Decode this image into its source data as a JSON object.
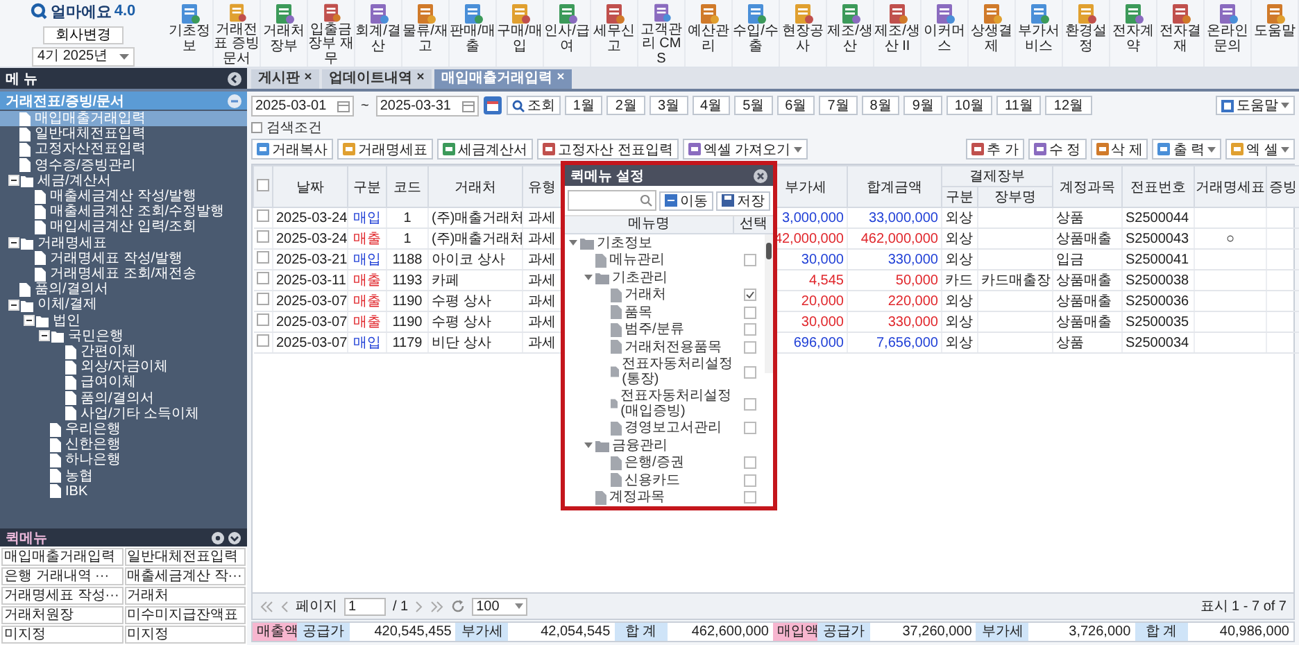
{
  "logo": {
    "name": "얼마에요",
    "version": "4.0"
  },
  "company_button": "회사변경",
  "period": "4기 2025년",
  "toolbar": [
    "기초정보",
    "거래전표 증빙문서",
    "거래처장부",
    "입출금장부 재무",
    "회계/결산",
    "물류/재고",
    "판매/매출",
    "구매/매입",
    "인사/급여",
    "세무신고",
    "고객관리 CMS",
    "예산관리",
    "수입/수출",
    "현장공사",
    "제조/생산",
    "제조/생산 II",
    "이커머스",
    "상생결제",
    "부가서비스",
    "환경설정",
    "전자계약",
    "전자결재",
    "온라인문의",
    "도움말"
  ],
  "menu_title": "메 뉴",
  "tabs": [
    {
      "label": "게시판",
      "selected": false
    },
    {
      "label": "업데이트내역",
      "selected": false
    },
    {
      "label": "매입매출거래입력",
      "selected": true
    }
  ],
  "sidebar": {
    "section": "거래전표/증빙/문서",
    "tree": [
      {
        "label": "매입매출거래입력",
        "kind": "file",
        "selected": true
      },
      {
        "label": "일반대체전표입력",
        "kind": "file",
        "selected": false
      },
      {
        "label": "고정자산전표입력",
        "kind": "file",
        "selected": false
      },
      {
        "label": "영수증/증빙관리",
        "kind": "file",
        "selected": false
      },
      {
        "label": "세금/계산서",
        "kind": "folder",
        "expanded": true,
        "selected": false,
        "children": [
          {
            "label": "매출세금계산 작성/발행",
            "kind": "file",
            "selected": false
          },
          {
            "label": "매출세금계산 조회/수정발행",
            "kind": "file",
            "selected": false
          },
          {
            "label": "매입세금계산 입력/조회",
            "kind": "file",
            "selected": false
          }
        ]
      },
      {
        "label": "거래명세표",
        "kind": "folder",
        "expanded": true,
        "selected": false,
        "children": [
          {
            "label": "거래명세표 작성/발행",
            "kind": "file",
            "selected": false
          },
          {
            "label": "거래명세표 조회/재전송",
            "kind": "file",
            "selected": false
          }
        ]
      },
      {
        "label": "품의/결의서",
        "kind": "file",
        "selected": false
      },
      {
        "label": "이체/결제",
        "kind": "folder",
        "expanded": true,
        "selected": false,
        "children": [
          {
            "label": "법인",
            "kind": "folder",
            "expanded": true,
            "selected": false,
            "children": [
              {
                "label": "국민은행",
                "kind": "folder",
                "expanded": true,
                "selected": false,
                "children": [
                  {
                    "label": "간편이체",
                    "kind": "file",
                    "selected": false
                  },
                  {
                    "label": "외상/자금이체",
                    "kind": "file",
                    "selected": false
                  },
                  {
                    "label": "급여이체",
                    "kind": "file",
                    "selected": false
                  },
                  {
                    "label": "품의/결의서",
                    "kind": "file",
                    "selected": false
                  },
                  {
                    "label": "사업/기타 소득이체",
                    "kind": "file",
                    "selected": false
                  }
                ]
              },
              {
                "label": "우리은행",
                "kind": "file",
                "selected": false
              },
              {
                "label": "신한은행",
                "kind": "file",
                "selected": false
              },
              {
                "label": "하나은행",
                "kind": "file",
                "selected": false
              },
              {
                "label": "농협",
                "kind": "file",
                "selected": false
              },
              {
                "label": "IBK",
                "kind": "file",
                "selected": false
              }
            ]
          }
        ]
      }
    ],
    "quick_title": "퀵메뉴",
    "quick_menu": [
      "매입매출거래입력",
      "일반대체전표입력",
      "은행 거래내역 ···",
      "매출세금계산 작···",
      "거래명세표 작성···",
      "거래처",
      "거래처원장",
      "미수미지급잔액표",
      "미지정",
      "미지정"
    ]
  },
  "filters": {
    "date_from": "2025-03-01",
    "tilde": "~",
    "date_to": "2025-03-31",
    "search_button": "조회",
    "months": [
      "1월",
      "2월",
      "3월",
      "4월",
      "5월",
      "6월",
      "7월",
      "8월",
      "9월",
      "10월",
      "11월",
      "12월"
    ],
    "help": "도움말"
  },
  "search_conditions": {
    "label": "검색조건",
    "expanded": false
  },
  "actions_left": [
    "거래복사",
    "거래명세표",
    "세금계산서",
    "고정자산 전표입력",
    "엑셀 가져오기"
  ],
  "actions_right": [
    "추 가",
    "수 정",
    "삭 제",
    "출 력",
    "엑 셀"
  ],
  "table": {
    "all_checked": false,
    "columns": [
      {
        "label": "날짜"
      },
      {
        "label": "구분"
      },
      {
        "label": "코드"
      },
      {
        "label": "거래처"
      },
      {
        "label": "유형"
      },
      {
        "label": "부가세"
      },
      {
        "label": "합계금액"
      },
      {
        "label": "결제장부",
        "children": [
          "구분",
          "장부명"
        ]
      },
      {
        "label": "계정과목"
      },
      {
        "label": "전표번호"
      },
      {
        "label": "거래명세표"
      },
      {
        "label": "증빙"
      }
    ],
    "rows": [
      {
        "checked": false,
        "kind": "purchase",
        "date": "2025-03-24",
        "type": "매입",
        "code": "1",
        "partner": "(주)매출거래처",
        "tax": "과세",
        "vat": "3,000,000",
        "total": "33,000,000",
        "pay": "외상",
        "account": "상품",
        "slip": "S2500044"
      },
      {
        "checked": false,
        "kind": "sale",
        "date": "2025-03-24",
        "type": "매출",
        "code": "1",
        "partner": "(주)매출거래처",
        "tax": "과세",
        "vat": "42,000,000",
        "total": "462,000,000",
        "pay": "외상",
        "account": "상품매출",
        "slip": "S2500043",
        "statement": "○"
      },
      {
        "checked": false,
        "kind": "purchase",
        "date": "2025-03-21",
        "type": "매입",
        "code": "1188",
        "partner": "아이코 상사",
        "tax": "과세",
        "vat": "30,000",
        "total": "330,000",
        "pay": "외상",
        "account": "입금",
        "slip": "S2500041"
      },
      {
        "checked": false,
        "kind": "sale",
        "date": "2025-03-11",
        "type": "매출",
        "code": "1193",
        "partner": "카페",
        "tax": "과세",
        "vat": "4,545",
        "total": "50,000",
        "pay": "카드",
        "book": "카드매출장",
        "account": "상품매출",
        "slip": "S2500038"
      },
      {
        "checked": false,
        "kind": "sale",
        "date": "2025-03-07",
        "type": "매출",
        "code": "1190",
        "partner": "수평 상사",
        "tax": "과세",
        "vat": "20,000",
        "total": "220,000",
        "pay": "외상",
        "account": "상품매출",
        "slip": "S2500036"
      },
      {
        "checked": false,
        "kind": "sale",
        "date": "2025-03-07",
        "type": "매출",
        "code": "1190",
        "partner": "수평 상사",
        "tax": "과세",
        "vat": "30,000",
        "total": "330,000",
        "pay": "외상",
        "account": "상품매출",
        "slip": "S2500035"
      },
      {
        "checked": false,
        "kind": "purchase",
        "date": "2025-03-07",
        "type": "매입",
        "code": "1179",
        "partner": "비단 상사",
        "tax": "과세",
        "vat": "696,000",
        "total": "7,656,000",
        "pay": "외상",
        "account": "상품",
        "slip": "S2500034"
      }
    ]
  },
  "popup": {
    "title": "퀵메뉴 설정",
    "move_button": "이동",
    "save_button": "저장",
    "col_name": "메뉴명",
    "col_select": "선택",
    "tree": [
      {
        "label": "기초정보",
        "kind": "folder",
        "expanded": true,
        "children": [
          {
            "label": "메뉴관리",
            "kind": "file",
            "checked": false
          },
          {
            "label": "기초관리",
            "kind": "folder",
            "expanded": true,
            "children": [
              {
                "label": "거래처",
                "kind": "file",
                "checked": true
              },
              {
                "label": "품목",
                "kind": "file",
                "checked": false
              },
              {
                "label": "범주/분류",
                "kind": "file",
                "checked": false
              },
              {
                "label": "거래처전용품목",
                "kind": "file",
                "checked": false
              },
              {
                "label": "전표자동처리설정(통장)",
                "kind": "file",
                "checked": false
              },
              {
                "label": "전표자동처리설정(매입증빙)",
                "kind": "file",
                "checked": false
              },
              {
                "label": "경영보고서관리",
                "kind": "file",
                "checked": false
              }
            ]
          },
          {
            "label": "금융관리",
            "kind": "folder",
            "expanded": true,
            "children": [
              {
                "label": "은행/증권",
                "kind": "file",
                "checked": false
              },
              {
                "label": "신용카드",
                "kind": "file",
                "checked": false
              }
            ]
          },
          {
            "label": "계정과목",
            "kind": "file",
            "checked": false
          }
        ]
      }
    ]
  },
  "pager": {
    "label": "페이지",
    "page": "1",
    "of": "/ 1",
    "size": "100",
    "summary": "표시 1 - 7 of 7"
  },
  "totals": [
    {
      "kind": "group",
      "text": "매출액"
    },
    {
      "kind": "label",
      "text": "공급가"
    },
    {
      "kind": "value",
      "text": "420,545,455"
    },
    {
      "kind": "label",
      "text": "부가세"
    },
    {
      "kind": "value",
      "text": "42,054,545"
    },
    {
      "kind": "label",
      "text": "합 계"
    },
    {
      "kind": "value",
      "text": "462,600,000"
    },
    {
      "kind": "group",
      "text": "매입액"
    },
    {
      "kind": "label",
      "text": "공급가"
    },
    {
      "kind": "value",
      "text": "37,260,000"
    },
    {
      "kind": "label",
      "text": "부가세"
    },
    {
      "kind": "value",
      "text": "3,726,000"
    },
    {
      "kind": "label",
      "text": "합 계"
    },
    {
      "kind": "value",
      "text": "40,986,000"
    }
  ]
}
